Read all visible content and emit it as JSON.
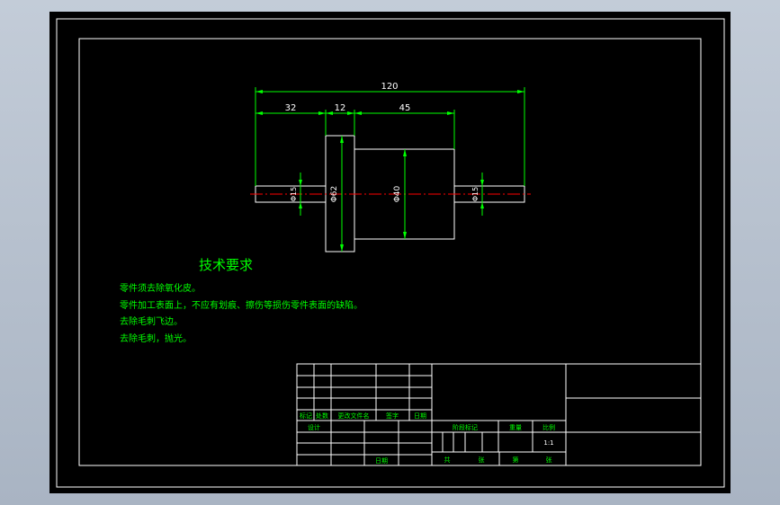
{
  "colors": {
    "background_outer": "#b7c0cd",
    "sheet": "#000000",
    "frame": "#ffffff",
    "dimension": "#00ff00",
    "centerline": "#ff0000",
    "text": "#00ff00"
  },
  "drawing": {
    "dimensions": {
      "overall": "120",
      "left_shaft": "32",
      "collar": "12",
      "body": "45",
      "collar_dia": "Φ62",
      "body_dia": "Φ40",
      "left_end_dia": "Φ15",
      "right_end_dia": "Φ15"
    }
  },
  "requirements": {
    "title": "技术要求",
    "items": [
      "零件须去除氧化皮。",
      "零件加工表面上，不应有划痕、擦伤等损伤零件表面的缺陷。",
      "去除毛刺飞边。",
      "去除毛刺，抛光。"
    ]
  },
  "title_block": {
    "rev_headers": [
      "标记",
      "处数",
      "更改文件名",
      "签字",
      "日期"
    ],
    "design_label": "设计",
    "date_label": "日期",
    "stage_label": "阶段标记",
    "weight_label": "重量",
    "scale_label": "比例",
    "scale_value": "1:1",
    "total_label": "共",
    "sheets_label": "张",
    "page_label": "第",
    "page_sheets_label": "张"
  }
}
